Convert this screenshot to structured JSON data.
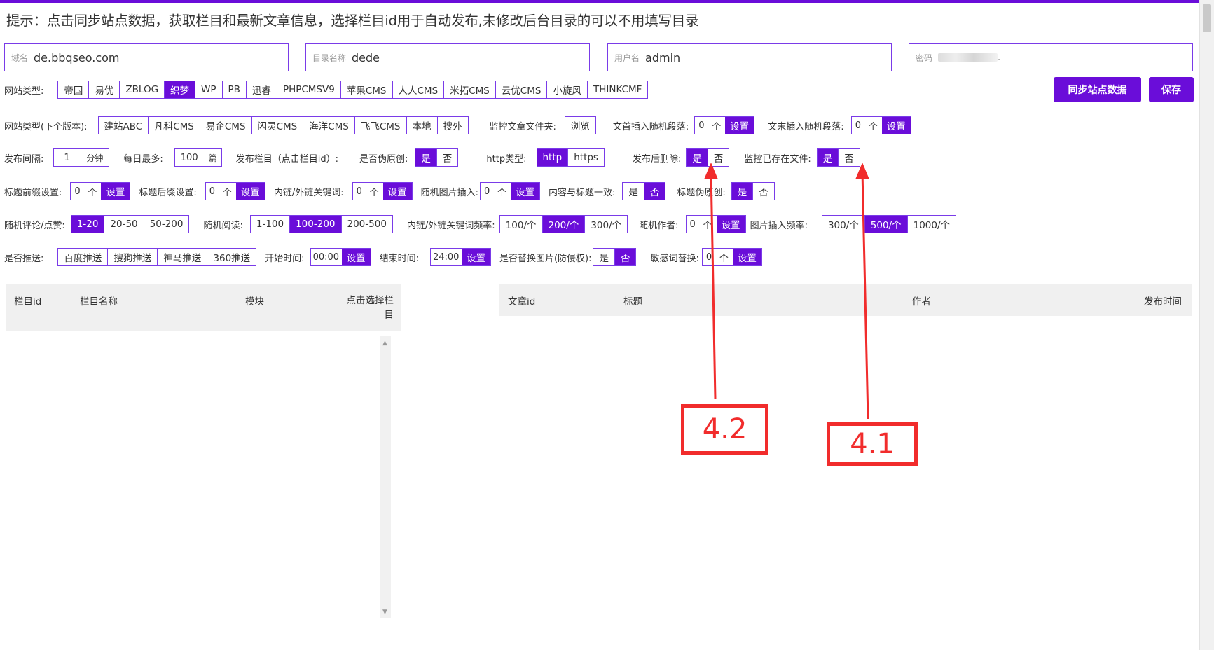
{
  "tip": "提示：点击同步站点数据，获取栏目和最新文章信息，选择栏目id用于自动发布,未修改后台目录的可以不用填写目录",
  "fields": {
    "domain": {
      "label": "域名",
      "value": "de.bbqseo.com"
    },
    "dir": {
      "label": "目录名称",
      "value": "dede"
    },
    "user": {
      "label": "用户名",
      "value": "admin"
    },
    "pwd": {
      "label": "密码",
      "value": "."
    }
  },
  "buttons": {
    "sync": "同步站点数据",
    "save": "保存"
  },
  "site_type": {
    "label": "网站类型:",
    "options": [
      "帝国",
      "易优",
      "ZBLOG",
      "织梦",
      "WP",
      "PB",
      "迅睿",
      "PHPCMSV9",
      "苹果CMS",
      "人人CMS",
      "米拓CMS",
      "云优CMS",
      "小旋风",
      "THINKCMF"
    ],
    "selected": "织梦"
  },
  "site_type_next": {
    "label": "网站类型(下个版本):",
    "options": [
      "建站ABC",
      "凡科CMS",
      "易企CMS",
      "闪灵CMS",
      "海洋CMS",
      "飞飞CMS",
      "本地",
      "搜外"
    ]
  },
  "monitor_folder": {
    "label": "监控文章文件夹:",
    "button": "浏览"
  },
  "head_insert": {
    "label": "文首插入随机段落:",
    "value": "0",
    "unit": "个",
    "button": "设置"
  },
  "tail_insert": {
    "label": "文末插入随机段落:",
    "value": "0",
    "unit": "个",
    "button": "设置"
  },
  "interval": {
    "label": "发布间隔:",
    "value": "1",
    "unit": "分钟"
  },
  "daily_max": {
    "label": "每日最多:",
    "value": "100",
    "unit": "篇"
  },
  "publish_cat": {
    "label": "发布栏目（点击栏目id）:"
  },
  "pseudo_original": {
    "label": "是否伪原创:",
    "options": [
      "是",
      "否"
    ],
    "selected": "是"
  },
  "http_type": {
    "label": "http类型:",
    "options": [
      "http",
      "https"
    ],
    "selected": "http"
  },
  "delete_after": {
    "label": "发布后删除:",
    "options": [
      "是",
      "否"
    ],
    "selected": "是"
  },
  "monitor_existing": {
    "label": "监控已存在文件:",
    "options": [
      "是",
      "否"
    ],
    "selected": "是"
  },
  "title_prefix": {
    "label": "标题前缀设置:",
    "value": "0",
    "unit": "个",
    "button": "设置"
  },
  "title_suffix": {
    "label": "标题后缀设置:",
    "value": "0",
    "unit": "个",
    "button": "设置"
  },
  "inner_links": {
    "label": "内链/外链关键词:",
    "value": "0",
    "unit": "个",
    "button": "设置"
  },
  "random_img": {
    "label": "随机图片插入:",
    "value": "0",
    "unit": "个",
    "button": "设置"
  },
  "content_title_same": {
    "label": "内容与标题一致:",
    "options": [
      "是",
      "否"
    ],
    "selected": "否"
  },
  "title_pseudo": {
    "label": "标题伪原创:",
    "options": [
      "是",
      "否"
    ],
    "selected": "是"
  },
  "random_comment": {
    "label": "随机评论/点赞:",
    "options": [
      "1-20",
      "20-50",
      "50-200"
    ],
    "selected": "1-20"
  },
  "random_read": {
    "label": "随机阅读:",
    "options": [
      "1-100",
      "100-200",
      "200-500"
    ],
    "selected": "100-200"
  },
  "link_freq": {
    "label": "内链/外链关键词频率:",
    "options": [
      "100/个",
      "200/个",
      "300/个"
    ],
    "selected": "200/个"
  },
  "random_author": {
    "label": "随机作者:",
    "value": "0",
    "unit": "个",
    "button": "设置"
  },
  "img_freq": {
    "label": "图片插入频率:",
    "options": [
      "300/个",
      "500/个",
      "1000/个"
    ],
    "selected": "500/个"
  },
  "push": {
    "label": "是否推送:",
    "options": [
      "百度推送",
      "搜狗推送",
      "神马推送",
      "360推送"
    ]
  },
  "start_time": {
    "label": "开始时间:",
    "value": "00:00",
    "button": "设置"
  },
  "end_time": {
    "label": "结束时间:",
    "value": "24:00",
    "button": "设置"
  },
  "replace_img": {
    "label": "是否替换图片(防侵权):",
    "options": [
      "是",
      "否"
    ],
    "selected": "否"
  },
  "sensitive": {
    "label": "敏感词替换:",
    "value": "0",
    "unit": "个",
    "button": "设置"
  },
  "cat_table": {
    "headers": [
      "栏目id",
      "栏目名称",
      "模块",
      "点击选择栏目"
    ]
  },
  "article_table": {
    "headers": [
      "文章id",
      "标题",
      "作者",
      "发布时间"
    ]
  },
  "annotations": [
    "4.2",
    "4.1"
  ],
  "colors": {
    "accent": "#6a0dd9",
    "annotation": "#f12c2c"
  }
}
